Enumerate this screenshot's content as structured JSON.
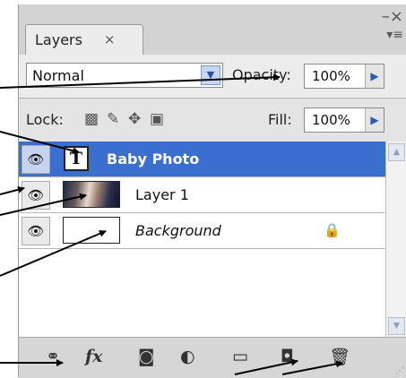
{
  "panel": {
    "tab_label": "Layers",
    "tab_close": "×",
    "close_glyph": "–×",
    "menu_glyph": "▾≡"
  },
  "blend": {
    "mode": "Normal",
    "opacity_label": "Opacity:",
    "opacity_value": "100%"
  },
  "lock": {
    "label": "Lock:",
    "fill_label": "Fill:",
    "fill_value": "100%"
  },
  "layers": [
    {
      "name": "Baby Photo",
      "kind": "type",
      "thumb_glyph": "T",
      "selected": true,
      "visible": true
    },
    {
      "name": "Layer 1",
      "kind": "image",
      "selected": false,
      "visible": true
    },
    {
      "name": "Background",
      "kind": "background",
      "selected": false,
      "visible": true,
      "locked": true
    }
  ],
  "bottom_icons": {
    "link": "link-icon",
    "fx": "fx",
    "mask": "mask-icon",
    "adjustment": "adjustment-icon",
    "group": "folder-icon",
    "new_layer": "new-layer-icon",
    "delete": "trash-icon"
  },
  "colors": {
    "selected_row": "#3a6fcf",
    "arrow": "#000000"
  }
}
